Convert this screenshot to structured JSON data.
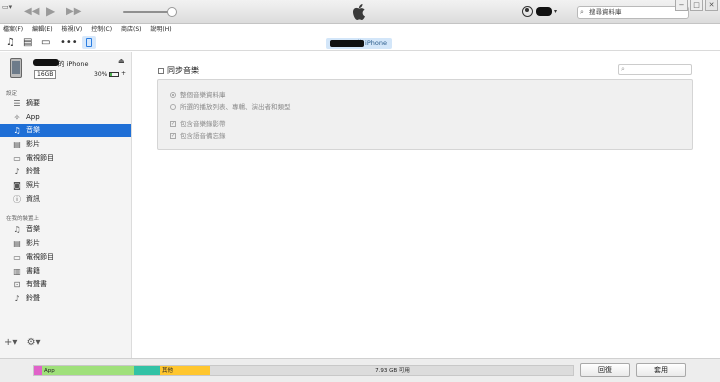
{
  "search": {
    "placeholder": "搜尋資料庫"
  },
  "menu": [
    "檔案(F)",
    "編輯(E)",
    "檢視(V)",
    "控制(C)",
    "商店(S)",
    "說明(H)"
  ],
  "toolbar": {
    "device_name": "的 iPhone"
  },
  "device": {
    "name": "的 iPhone",
    "capacity": "16GB",
    "battery": "30%",
    "battery_level": 0.3
  },
  "sidebar": {
    "settings_label": "設定",
    "settings_items": [
      {
        "label": "摘要",
        "icon": "summary-icon"
      },
      {
        "label": "App",
        "icon": "app-icon"
      },
      {
        "label": "音樂",
        "icon": "music-note-icon"
      },
      {
        "label": "影片",
        "icon": "film-icon"
      },
      {
        "label": "電視節目",
        "icon": "tv-icon"
      },
      {
        "label": "鈴聲",
        "icon": "bell-icon"
      },
      {
        "label": "照片",
        "icon": "camera-icon"
      },
      {
        "label": "資訊",
        "icon": "info-icon"
      }
    ],
    "on_device_label": "在我的裝置上",
    "device_items": [
      {
        "label": "音樂",
        "icon": "music-note-icon"
      },
      {
        "label": "影片",
        "icon": "film-icon"
      },
      {
        "label": "電視節目",
        "icon": "tv-icon"
      },
      {
        "label": "書籍",
        "icon": "book-icon"
      },
      {
        "label": "有聲書",
        "icon": "audiobook-icon"
      },
      {
        "label": "鈴聲",
        "icon": "bell-icon"
      }
    ]
  },
  "main": {
    "sync_label": "同步音樂",
    "options": {
      "entire_library": "整個音樂資料庫",
      "selected": "所選的播放列表、專輯、演出者和類型",
      "include_videos": "包含音樂錄影帶",
      "include_voice_memos": "包含語音備忘錄"
    }
  },
  "storage": {
    "segments": [
      {
        "label": "",
        "color": "#e062c9"
      },
      {
        "label": "App",
        "color": "#9fe07a"
      },
      {
        "label": "",
        "color": "#32c2a5"
      },
      {
        "label": "其他",
        "color": "#ffc62e"
      },
      {
        "label": "7.93 GB 可用",
        "color": "#dcdcdc"
      }
    ]
  },
  "buttons": {
    "revert": "回復",
    "apply": "套用"
  }
}
